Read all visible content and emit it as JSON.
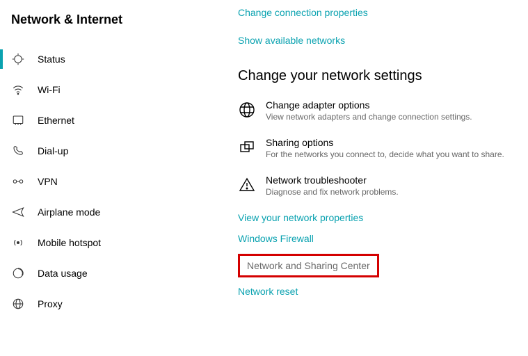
{
  "sidebar": {
    "title": "Network & Internet",
    "items": [
      {
        "label": "Status"
      },
      {
        "label": "Wi-Fi"
      },
      {
        "label": "Ethernet"
      },
      {
        "label": "Dial-up"
      },
      {
        "label": "VPN"
      },
      {
        "label": "Airplane mode"
      },
      {
        "label": "Mobile hotspot"
      },
      {
        "label": "Data usage"
      },
      {
        "label": "Proxy"
      }
    ]
  },
  "main": {
    "top_links": {
      "change_connection": "Change connection properties",
      "show_networks": "Show available networks"
    },
    "section_title": "Change your network settings",
    "options": {
      "adapter": {
        "title": "Change adapter options",
        "desc": "View network adapters and change connection settings."
      },
      "sharing": {
        "title": "Sharing options",
        "desc": "For the networks you connect to, decide what you want to share."
      },
      "troubleshoot": {
        "title": "Network troubleshooter",
        "desc": "Diagnose and fix network problems."
      }
    },
    "bottom_links": {
      "properties": "View your network properties",
      "firewall": "Windows Firewall",
      "sharing_center": "Network and Sharing Center",
      "reset": "Network reset"
    }
  }
}
